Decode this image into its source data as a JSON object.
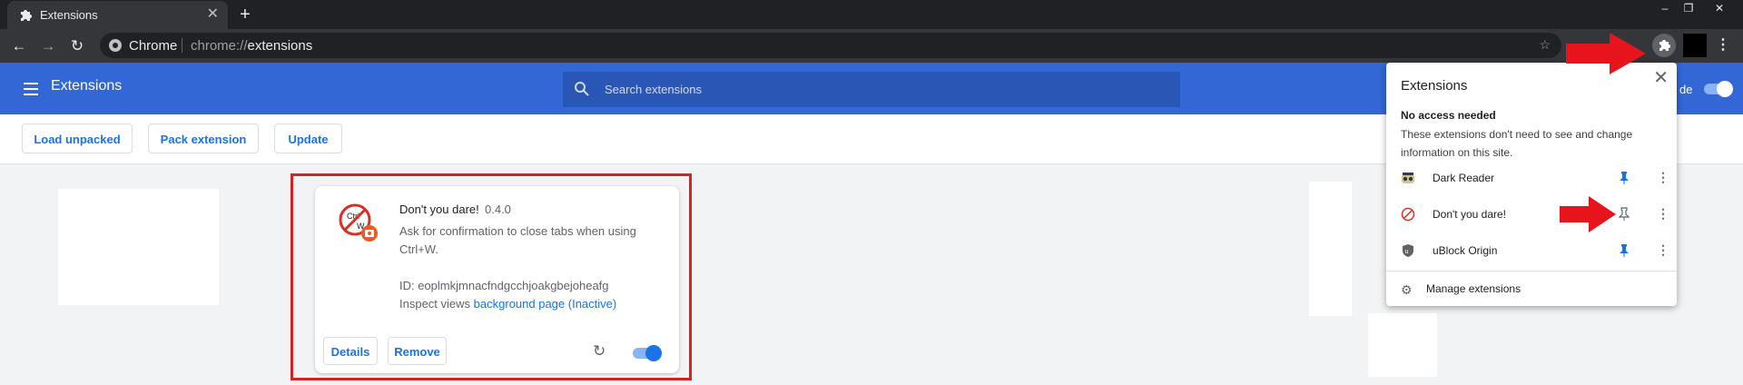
{
  "browser": {
    "tab_title": "Extensions",
    "tab_close": "✕",
    "new_tab": "+",
    "window_controls": {
      "minimize": "–",
      "restore": "❐",
      "close": "✕"
    },
    "omnibox_label": "Chrome",
    "url_scheme": "chrome://",
    "url_path": "extensions",
    "menu_dots": "⋮"
  },
  "header": {
    "title": "Extensions",
    "search_placeholder": "Search extensions",
    "developer_mode_label": "de"
  },
  "actions": {
    "load_unpacked": "Load unpacked",
    "pack_extension": "Pack extension",
    "update": "Update"
  },
  "card": {
    "name": "Don't you dare!",
    "version": "0.4.0",
    "description": "Ask for confirmation to close tabs when using Ctrl+W.",
    "id_line": "ID: eoplmkjmnacfndgcchjoakgbejoheafg",
    "inspect_prefix": "Inspect views",
    "inspect_link": "background page (Inactive)",
    "details_button": "Details",
    "remove_button": "Remove",
    "enabled": true
  },
  "popup": {
    "title": "Extensions",
    "close": "✕",
    "section_title": "No access needed",
    "section_desc": "These extensions don't need to see and change information on this site.",
    "items": [
      {
        "name": "Dark Reader",
        "icon": "dark-reader-icon",
        "pinned": true
      },
      {
        "name": "Don't you dare!",
        "icon": "dont-you-dare-icon",
        "pinned": false
      },
      {
        "name": "uBlock Origin",
        "icon": "ublock-origin-icon",
        "pinned": true
      }
    ],
    "manage_label": "Manage extensions"
  },
  "colors": {
    "header_blue": "#3367d6",
    "accent_blue": "#1a73e8",
    "annotation_red": "#d92025"
  }
}
